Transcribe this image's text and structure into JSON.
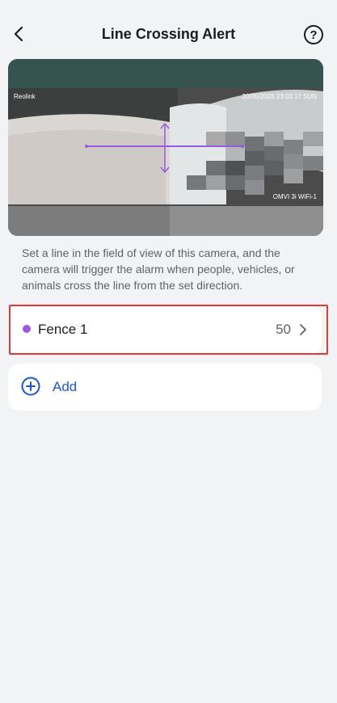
{
  "header": {
    "title": "Line Crossing Alert"
  },
  "help": {
    "label": "?"
  },
  "camera_preview": {
    "brand_watermark": "Reolink",
    "timestamp": "20/05/2026 23:03:17 SUN",
    "camera_name": "OMVI 3i WiFi-1"
  },
  "description": "Set a line in the field of view of this camera, and the camera will trigger the alarm when people, vehicles, or animals cross the line from the set direction.",
  "fences": [
    {
      "name": "Fence 1",
      "value": "50",
      "color": "#9b59e0"
    }
  ],
  "add": {
    "label": "Add"
  },
  "colors": {
    "accent": "#1a56c9",
    "highlight": "#e53935",
    "line": "#9b59e0"
  }
}
